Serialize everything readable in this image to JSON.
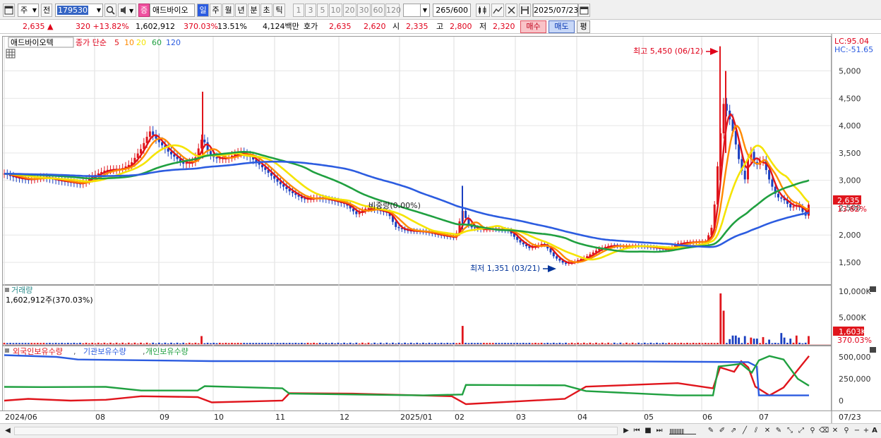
{
  "toolbar": {
    "market_type": "주",
    "prev_label": "전",
    "code": "179530",
    "name": "애드바이오",
    "flag": "증",
    "periods": [
      "일",
      "주",
      "월",
      "년",
      "분",
      "초",
      "틱"
    ],
    "minute_units": [
      "1",
      "3",
      "5",
      "10",
      "20",
      "30",
      "60",
      "120"
    ],
    "bar_count": "265",
    "bar_total": "/600",
    "date": "2025/07/23"
  },
  "quote": {
    "price": "2,635",
    "change": "320",
    "change_pct": "+13.82%",
    "volume": "1,602,912",
    "volume_ratio": "370.03%",
    "turnover": "13.51%",
    "amount": "4,124백만",
    "hoga_label": "호가",
    "ask": "2,635",
    "bid": "2,620",
    "open_label": "시",
    "open": "2,335",
    "high_label": "고",
    "high": "2,800",
    "low_label": "저",
    "low": "2,320",
    "buy_button": "매수",
    "sell_button": "매도",
    "eval_button": "평"
  },
  "main_pane": {
    "name_tag": "애드바이오텍",
    "ma_legend_label": "종가 단순",
    "ma_periods": [
      "5",
      "10",
      "20",
      "60",
      "120"
    ],
    "ma_colors": [
      "#e0151c",
      "#ff8a00",
      "#f5e400",
      "#20a040",
      "#2c5ce0"
    ],
    "lc_text": "LC:95.04",
    "hc_text": "HC:-51.65",
    "high_annotation": "최고 5,450 (06/12)",
    "low_annotation": "최저 1,351 (03/21)",
    "hold_annotation": "비중량(0.00%)",
    "y_ticks": [
      "5,000",
      "4,500",
      "4,000",
      "3,500",
      "3,000",
      "2,500",
      "2,000",
      "1,500"
    ],
    "price_tag": "2,635",
    "pct_tag": "13.82%"
  },
  "volume_pane": {
    "title": "거래량",
    "value": "1,602,912주(370.03%)",
    "y_ticks": [
      "10,000K",
      "5,000K"
    ],
    "value_tag": "1,603K",
    "pct_tag": "370.03%"
  },
  "holding_pane": {
    "labels": [
      "외국인보유수량",
      "기관보유수량",
      "개인보유수량"
    ],
    "colors": [
      "#e0151c",
      "#2c5ce0",
      "#20a040"
    ],
    "y_ticks": [
      "500,000",
      "250,000",
      "0"
    ]
  },
  "x_axis": {
    "labels": [
      "2024/06",
      "08",
      "09",
      "10",
      "11",
      "12",
      "2025/01",
      "02",
      "03",
      "04",
      "05",
      "06",
      "07"
    ],
    "right_label": "07/23"
  }
}
